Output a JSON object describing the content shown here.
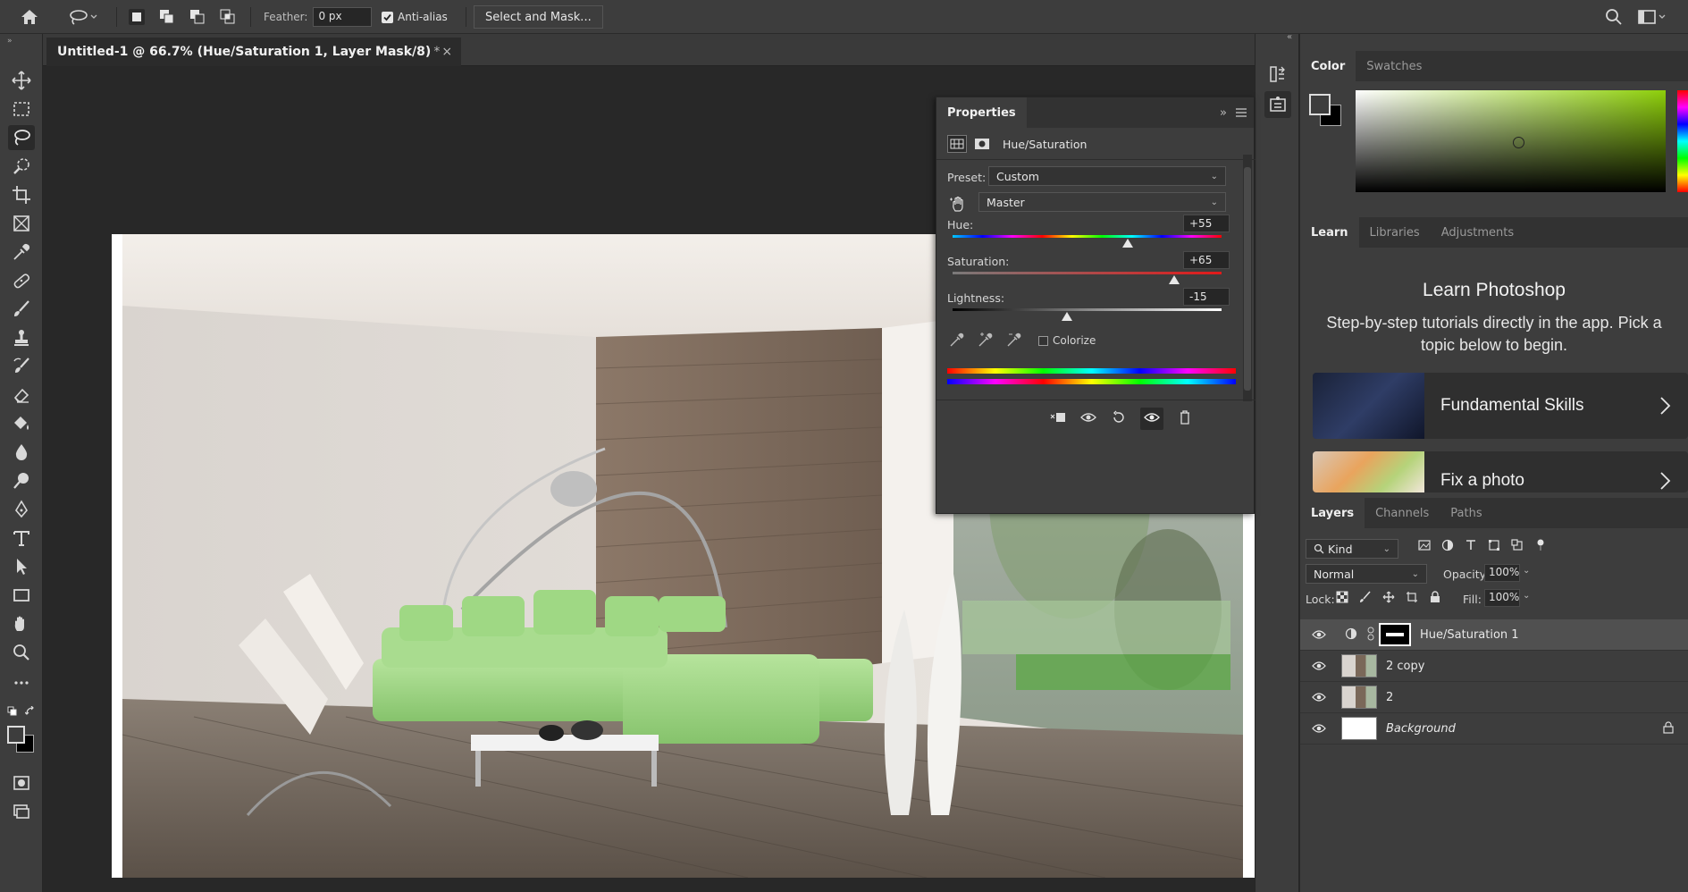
{
  "options_bar": {
    "feather_label": "Feather:",
    "feather_value": "0 px",
    "anti_alias_label": "Anti-alias",
    "anti_alias_checked": true,
    "select_mask_label": "Select and Mask..."
  },
  "document": {
    "tab_title": "Untitled-1 @ 66.7% (Hue/Saturation 1, Layer Mask/8)",
    "tab_modified": "*",
    "tab_close": "×"
  },
  "properties": {
    "title": "Properties",
    "adjustment_name": "Hue/Saturation",
    "preset_label": "Preset:",
    "preset_value": "Custom",
    "channel_value": "Master",
    "hue_label": "Hue:",
    "hue_value": "+55",
    "saturation_label": "Saturation:",
    "saturation_value": "+65",
    "lightness_label": "Lightness:",
    "lightness_value": "-15",
    "colorize_label": "Colorize",
    "colorize_checked": false,
    "hue_level": 55,
    "saturation_level": 65,
    "lightness_level": -15
  },
  "color_panel": {
    "tabs": [
      "Color",
      "Swatches"
    ],
    "active_tab": "Color",
    "hue_color": "#8ecf0a"
  },
  "learn_panel": {
    "tabs": [
      "Learn",
      "Libraries",
      "Adjustments"
    ],
    "heading": "Learn Photoshop",
    "subtitle": "Step-by-step tutorials directly in the app. Pick a topic below to begin.",
    "cards": [
      "Fundamental Skills",
      "Fix a photo"
    ]
  },
  "layers_panel": {
    "tabs": [
      "Layers",
      "Channels",
      "Paths"
    ],
    "filter_kind": "Kind",
    "blend_mode": "Normal",
    "opacity_label": "Opacity:",
    "opacity_value": "100%",
    "lock_label": "Lock:",
    "fill_label": "Fill:",
    "fill_value": "100%",
    "layers": [
      {
        "name": "Hue/Saturation 1",
        "selected": true
      },
      {
        "name": "2 copy",
        "selected": false
      },
      {
        "name": "2",
        "selected": false
      },
      {
        "name": "Background",
        "selected": false,
        "italic": true,
        "locked": true
      }
    ]
  },
  "colors": {
    "accent_green": "#9ed67a",
    "panel_bg": "#3d3d3d"
  }
}
